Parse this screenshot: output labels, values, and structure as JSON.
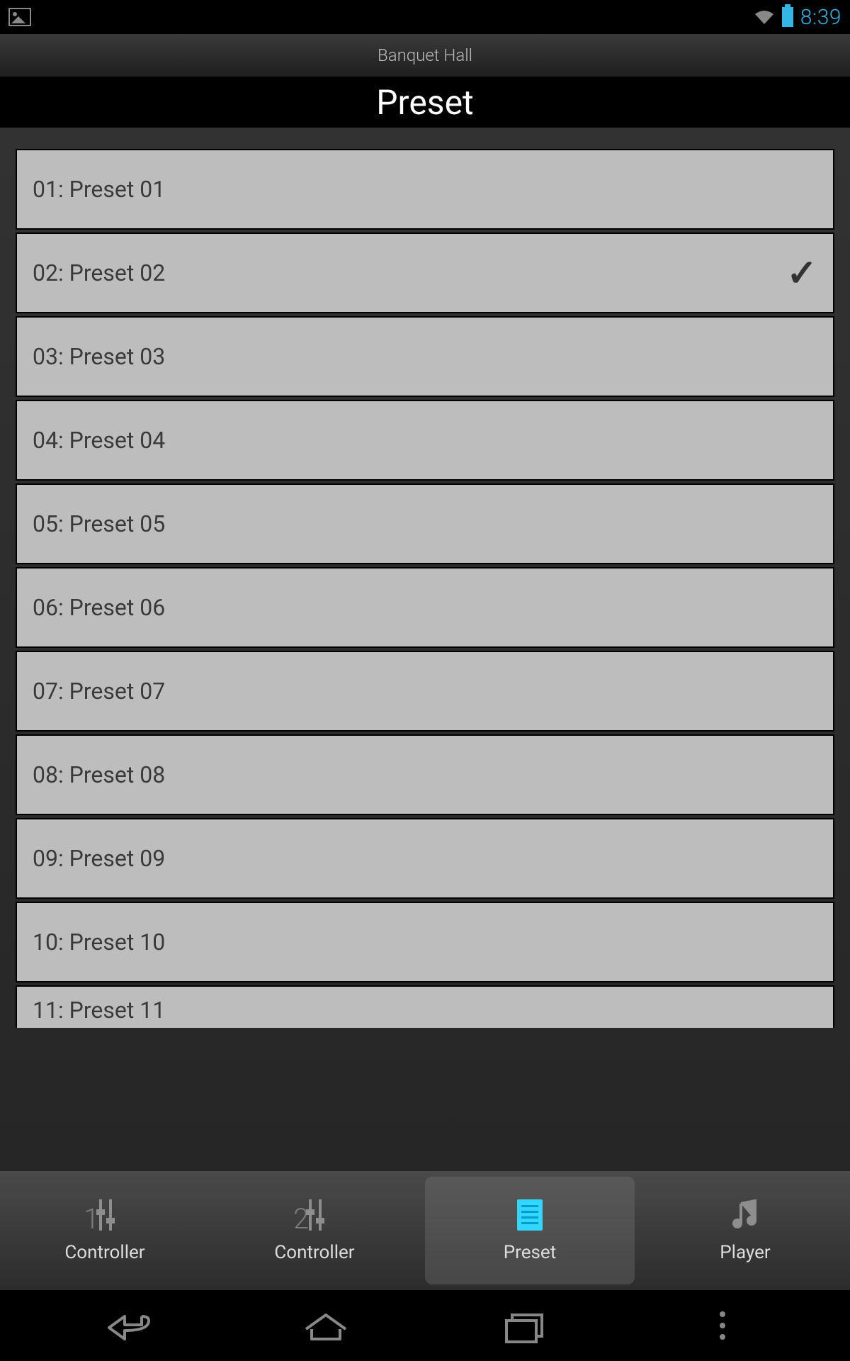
{
  "status": {
    "time": "8:39"
  },
  "header": {
    "subtitle": "Banquet Hall",
    "title": "Preset"
  },
  "presets": [
    {
      "label": "01: Preset 01",
      "selected": false
    },
    {
      "label": "02: Preset 02",
      "selected": true
    },
    {
      "label": "03: Preset 03",
      "selected": false
    },
    {
      "label": "04: Preset 04",
      "selected": false
    },
    {
      "label": "05: Preset 05",
      "selected": false
    },
    {
      "label": "06: Preset 06",
      "selected": false
    },
    {
      "label": "07: Preset 07",
      "selected": false
    },
    {
      "label": "08: Preset 08",
      "selected": false
    },
    {
      "label": "09: Preset 09",
      "selected": false
    },
    {
      "label": "10: Preset 10",
      "selected": false
    },
    {
      "label": "11: Preset 11",
      "selected": false
    }
  ],
  "tabs": [
    {
      "label": "Controller",
      "icon_num": "1",
      "active": false
    },
    {
      "label": "Controller",
      "icon_num": "2",
      "active": false
    },
    {
      "label": "Preset",
      "icon_num": "",
      "active": true
    },
    {
      "label": "Player",
      "icon_num": "",
      "active": false
    }
  ]
}
